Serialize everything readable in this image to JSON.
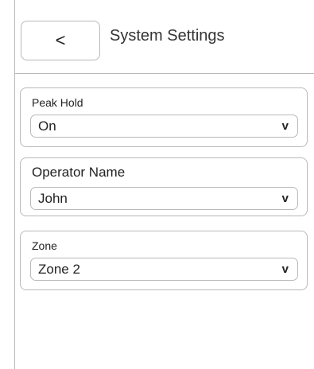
{
  "header": {
    "back_label": "<",
    "title": "System Settings"
  },
  "settings": [
    {
      "label": "Peak Hold",
      "value": "On",
      "chevron": "v"
    },
    {
      "label": "Operator Name",
      "value": "John",
      "chevron": "v"
    },
    {
      "label": "Zone",
      "value": "Zone 2",
      "chevron": "v"
    }
  ]
}
